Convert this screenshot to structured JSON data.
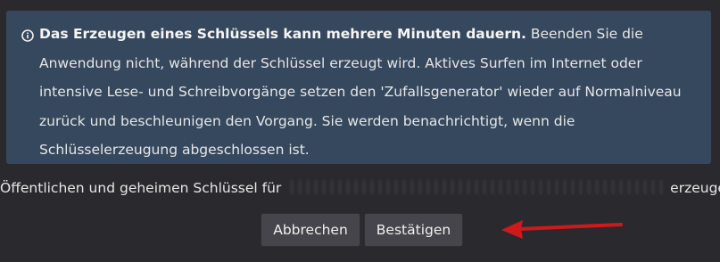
{
  "info": {
    "icon": "info-circle-icon",
    "bold_text": "Das Erzeugen eines Schlüssels kann mehrere Minuten dauern.",
    "body_text": "Beenden Sie die Anwendung nicht, während der Schlüssel erzeugt wird. Aktives Surfen im Internet oder intensive Lese- und Schreibvorgänge setzen den 'Zufallsgenerator' wieder auf Normalniveau zurück und beschleunigen den Vorgang. Sie werden benachrichtigt, wenn die Schlüsselerzeugung abgeschlossen ist."
  },
  "question": {
    "prefix": "Öffentlichen und geheimen Schlüssel für",
    "suffix": "erzeugen?"
  },
  "buttons": {
    "cancel_label": "Abbrechen",
    "confirm_label": "Bestätigen"
  },
  "colors": {
    "background": "#2a2a2e",
    "info_box": "#36485e",
    "button": "#45454b",
    "annotation_arrow": "#d0191b"
  }
}
